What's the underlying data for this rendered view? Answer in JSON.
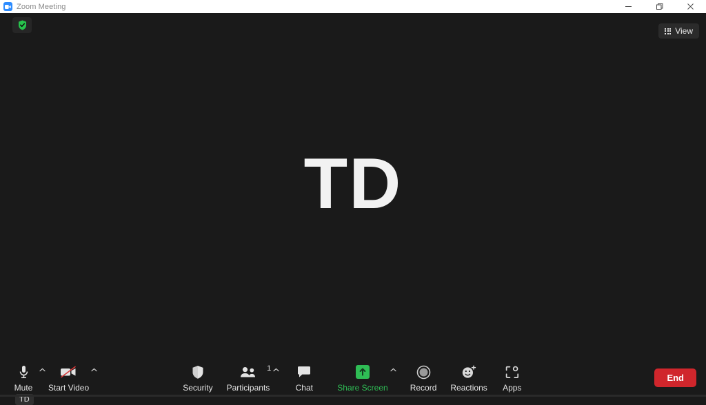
{
  "window": {
    "title": "Zoom Meeting",
    "app_icon": "zoom-camera-icon",
    "controls": {
      "minimize": "minimize-icon",
      "maximize": "restore-icon",
      "close": "close-icon"
    }
  },
  "stage": {
    "encryption_badge": "shield-check-icon",
    "view_button": {
      "label": "View",
      "icon": "grid-icon"
    },
    "active_speaker": {
      "initials": "TD",
      "self_name_tag": "TD"
    },
    "background_color": "#1a1a1a"
  },
  "toolbar": {
    "background_color": "#1a1a1a",
    "left_items": [
      {
        "label": "Mute",
        "icon": "microphone-icon",
        "has_chevron": true
      },
      {
        "label": "Start Video",
        "icon": "video-camera-off-icon",
        "has_chevron": true
      }
    ],
    "center_items": [
      {
        "label": "Security",
        "icon": "shield-icon",
        "has_chevron": false,
        "count": ""
      },
      {
        "label": "Participants",
        "icon": "participants-icon",
        "has_chevron": true,
        "count": "1"
      },
      {
        "label": "Chat",
        "icon": "chat-bubble-icon",
        "has_chevron": false,
        "count": ""
      },
      {
        "label": "Share Screen",
        "icon": "share-screen-icon",
        "has_chevron": true,
        "count": "",
        "accent": "#2fbd55"
      },
      {
        "label": "Record",
        "icon": "record-circle-icon",
        "has_chevron": false,
        "count": ""
      },
      {
        "label": "Reactions",
        "icon": "reactions-smiley-icon",
        "has_chevron": false,
        "count": ""
      },
      {
        "label": "Apps",
        "icon": "apps-icon",
        "has_chevron": false,
        "count": ""
      }
    ],
    "end_button": {
      "label": "End",
      "color": "#d0262c"
    }
  }
}
